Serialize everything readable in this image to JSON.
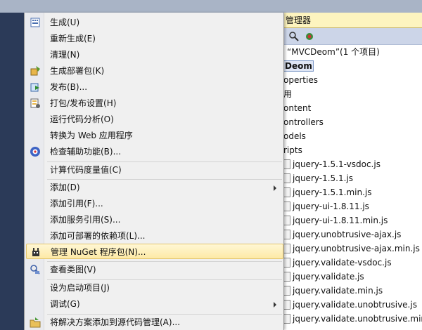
{
  "menu": {
    "items": [
      {
        "label": "生成(U)",
        "icon": "build-icon"
      },
      {
        "label": "重新生成(E)",
        "icon": ""
      },
      {
        "label": "清理(N)",
        "icon": ""
      },
      {
        "label": "生成部署包(K)",
        "icon": "package-icon"
      },
      {
        "label": "发布(B)...",
        "icon": "publish-icon"
      },
      {
        "label": "打包/发布设置(H)",
        "icon": "package-settings-icon"
      },
      {
        "label": "运行代码分析(O)",
        "icon": ""
      },
      {
        "label": "转换为 Web 应用程序",
        "icon": ""
      },
      {
        "label": "检查辅助功能(B)...",
        "icon": "accessibility-icon"
      },
      {
        "label": "计算代码度量值(C)",
        "icon": ""
      },
      {
        "label": "添加(D)",
        "icon": "",
        "submenu": true
      },
      {
        "label": "添加引用(F)...",
        "icon": ""
      },
      {
        "label": "添加服务引用(S)...",
        "icon": ""
      },
      {
        "label": "添加可部署的依赖项(L)...",
        "icon": ""
      },
      {
        "label": "管理 NuGet 程序包(N)...",
        "icon": "nuget-icon",
        "highlighted": true
      },
      {
        "label": "查看类图(V)",
        "icon": "class-diagram-icon"
      },
      {
        "label": "设为启动项目(J)",
        "icon": ""
      },
      {
        "label": "调试(G)",
        "icon": "",
        "submenu": true
      },
      {
        "label": "将解决方案添加到源代码管理(A)...",
        "icon": "source-control-icon"
      }
    ]
  },
  "solution_explorer": {
    "title": "管理器",
    "rows": [
      "“MVCDeom”(1 个项目)",
      "Deom",
      "operties",
      "用",
      "ontent",
      "ontrollers",
      "odels",
      "ripts",
      "jquery-1.5.1-vsdoc.js",
      "jquery-1.5.1.js",
      "jquery-1.5.1.min.js",
      "jquery-ui-1.8.11.js",
      "jquery-ui-1.8.11.min.js",
      "jquery.unobtrusive-ajax.js",
      "jquery.unobtrusive-ajax.min.js",
      "jquery.validate-vsdoc.js",
      "jquery.validate.js",
      "jquery.validate.min.js",
      "jquery.validate.unobtrusive.js",
      "jquery.validate.unobtrusive.min.js"
    ]
  },
  "colors": {
    "highlight": "#fde9a6",
    "menu_bg": "#f0f0f0",
    "ide_bg": "#2b3a58"
  }
}
